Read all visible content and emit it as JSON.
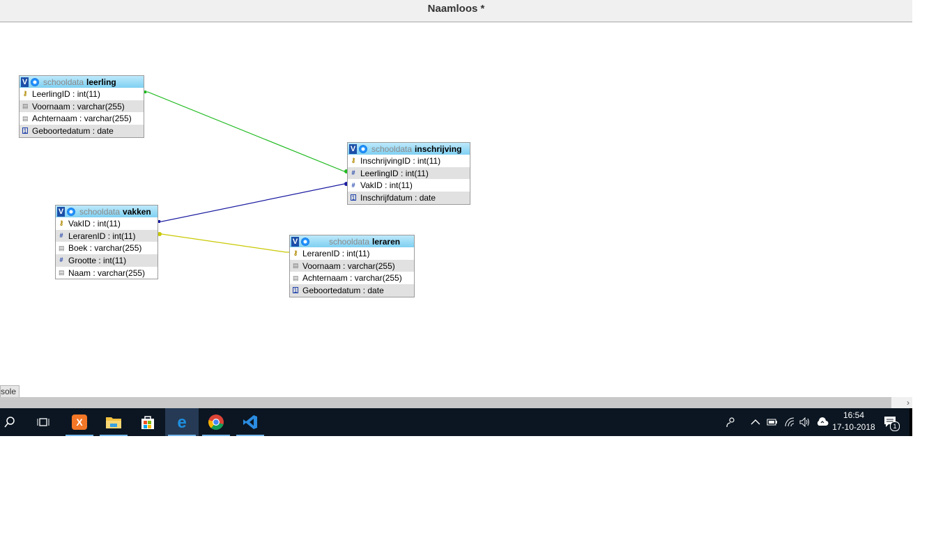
{
  "window": {
    "title": "Naamloos *"
  },
  "tables": [
    {
      "schema": "schooldata",
      "name": "leerling",
      "columns": [
        {
          "label": "LeerlingID : int(11)",
          "icon": "key-icon"
        },
        {
          "label": "Voornaam : varchar(255)",
          "icon": "text-icon"
        },
        {
          "label": "Achternaam : varchar(255)",
          "icon": "text-icon"
        },
        {
          "label": "Geboortedatum : date",
          "icon": "date-icon"
        }
      ]
    },
    {
      "schema": "schooldata",
      "name": "inschrijving",
      "columns": [
        {
          "label": "InschrijvingID : int(11)",
          "icon": "key-icon"
        },
        {
          "label": "LeerlingID : int(11)",
          "icon": "index-icon"
        },
        {
          "label": "VakID : int(11)",
          "icon": "index-icon"
        },
        {
          "label": "Inschrijfdatum : date",
          "icon": "date-icon"
        }
      ]
    },
    {
      "schema": "schooldata",
      "name": "vakken",
      "columns": [
        {
          "label": "VakID : int(11)",
          "icon": "key-icon"
        },
        {
          "label": "LerarenID : int(11)",
          "icon": "index-icon"
        },
        {
          "label": "Boek : varchar(255)",
          "icon": "text-icon"
        },
        {
          "label": "Grootte : int(11)",
          "icon": "index-icon"
        },
        {
          "label": "Naam : varchar(255)",
          "icon": "text-icon"
        }
      ]
    },
    {
      "schema": "schooldata",
      "name": "leraren",
      "columns": [
        {
          "label": "LerarenID : int(11)",
          "icon": "key-icon"
        },
        {
          "label": "Voornaam : varchar(255)",
          "icon": "text-icon"
        },
        {
          "label": "Achternaam : varchar(255)",
          "icon": "text-icon"
        },
        {
          "label": "Geboortedatum : date",
          "icon": "date-icon"
        }
      ]
    }
  ],
  "relations": [
    {
      "from": "leerling.LeerlingID",
      "to": "inschrijving.LeerlingID",
      "color": "#22bb22"
    },
    {
      "from": "vakken.VakID",
      "to": "inschrijving.VakID",
      "color": "#1a1aa0"
    },
    {
      "from": "vakken.LerarenID",
      "to": "leraren.LerarenID",
      "color": "#c8c800"
    }
  ],
  "console_tab": "sole",
  "taskbar": {
    "apps": [
      "search-icon",
      "task-view-icon",
      "xampp-icon",
      "file-explorer-icon",
      "store-icon",
      "edge-icon",
      "chrome-icon",
      "vscode-icon"
    ],
    "clock": {
      "time": "16:54",
      "date": "17-10-2018"
    },
    "notifications": "1"
  },
  "colors": {
    "header": "#7fd0f2",
    "taskbar": "#0b1622"
  }
}
